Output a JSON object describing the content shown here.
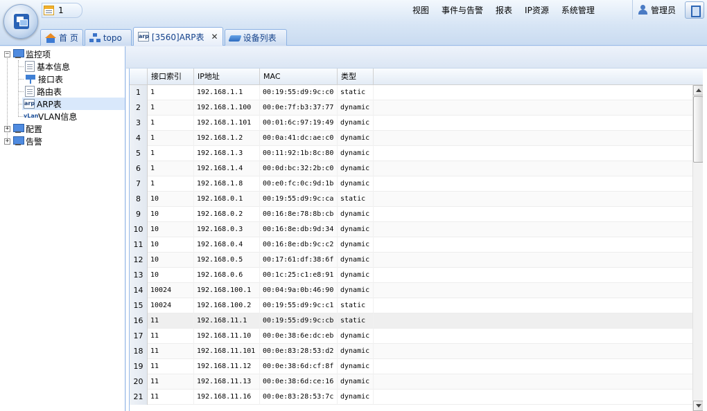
{
  "header": {
    "notification_count": "1",
    "menu": [
      "视图",
      "事件与告警",
      "报表",
      "IP资源",
      "系统管理"
    ],
    "user": "管理员"
  },
  "tabs": [
    {
      "label": "首 页",
      "icon": "home-icon"
    },
    {
      "label": "topo",
      "icon": "topology-icon"
    },
    {
      "label": "[3560]ARP表",
      "icon": "arp-table-icon",
      "badge": "arp",
      "active": true,
      "close": "✕"
    },
    {
      "label": "设备列表",
      "icon": "device-list-icon"
    }
  ],
  "tree": {
    "root": {
      "label": "监控项",
      "toggle": "−"
    },
    "children": [
      {
        "label": "基本信息",
        "icon": "basic-info-icon"
      },
      {
        "label": "接口表",
        "icon": "interface-icon"
      },
      {
        "label": "路由表",
        "icon": "route-table-icon"
      },
      {
        "label": "ARP表",
        "icon": "arp-icon",
        "badge": "arp",
        "selected": true
      },
      {
        "label": "VLAN信息",
        "icon": "vlan-icon",
        "badge": "vLan"
      }
    ],
    "others": [
      {
        "label": "配置",
        "toggle": "+"
      },
      {
        "label": "告警",
        "toggle": "+"
      }
    ]
  },
  "grid": {
    "columns": [
      "接口索引",
      "IP地址",
      "MAC",
      "类型"
    ],
    "rows": [
      {
        "n": "1",
        "idx": "1",
        "ip": "192.168.1.1",
        "mac": "00:19:55:d9:9c:c0",
        "type": "static"
      },
      {
        "n": "2",
        "idx": "1",
        "ip": "192.168.1.100",
        "mac": "00:0e:7f:b3:37:77",
        "type": "dynamic"
      },
      {
        "n": "3",
        "idx": "1",
        "ip": "192.168.1.101",
        "mac": "00:01:6c:97:19:49",
        "type": "dynamic"
      },
      {
        "n": "4",
        "idx": "1",
        "ip": "192.168.1.2",
        "mac": "00:0a:41:dc:ae:c0",
        "type": "dynamic"
      },
      {
        "n": "5",
        "idx": "1",
        "ip": "192.168.1.3",
        "mac": "00:11:92:1b:8c:80",
        "type": "dynamic"
      },
      {
        "n": "6",
        "idx": "1",
        "ip": "192.168.1.4",
        "mac": "00:0d:bc:32:2b:c0",
        "type": "dynamic"
      },
      {
        "n": "7",
        "idx": "1",
        "ip": "192.168.1.8",
        "mac": "00:e0:fc:0c:9d:1b",
        "type": "dynamic"
      },
      {
        "n": "8",
        "idx": "10",
        "ip": "192.168.0.1",
        "mac": "00:19:55:d9:9c:ca",
        "type": "static"
      },
      {
        "n": "9",
        "idx": "10",
        "ip": "192.168.0.2",
        "mac": "00:16:8e:78:8b:cb",
        "type": "dynamic"
      },
      {
        "n": "10",
        "idx": "10",
        "ip": "192.168.0.3",
        "mac": "00:16:8e:db:9d:34",
        "type": "dynamic"
      },
      {
        "n": "11",
        "idx": "10",
        "ip": "192.168.0.4",
        "mac": "00:16:8e:db:9c:c2",
        "type": "dynamic"
      },
      {
        "n": "12",
        "idx": "10",
        "ip": "192.168.0.5",
        "mac": "00:17:61:df:38:6f",
        "type": "dynamic"
      },
      {
        "n": "13",
        "idx": "10",
        "ip": "192.168.0.6",
        "mac": "00:1c:25:c1:e8:91",
        "type": "dynamic"
      },
      {
        "n": "14",
        "idx": "10024",
        "ip": "192.168.100.1",
        "mac": "00:04:9a:0b:46:90",
        "type": "dynamic"
      },
      {
        "n": "15",
        "idx": "10024",
        "ip": "192.168.100.2",
        "mac": "00:19:55:d9:9c:c1",
        "type": "static"
      },
      {
        "n": "16",
        "idx": "11",
        "ip": "192.168.11.1",
        "mac": "00:19:55:d9:9c:cb",
        "type": "static"
      },
      {
        "n": "17",
        "idx": "11",
        "ip": "192.168.11.10",
        "mac": "00:0e:38:6e:dc:eb",
        "type": "dynamic"
      },
      {
        "n": "18",
        "idx": "11",
        "ip": "192.168.11.101",
        "mac": "00:0e:83:28:53:d2",
        "type": "dynamic"
      },
      {
        "n": "19",
        "idx": "11",
        "ip": "192.168.11.12",
        "mac": "00:0e:38:6d:cf:8f",
        "type": "dynamic"
      },
      {
        "n": "20",
        "idx": "11",
        "ip": "192.168.11.13",
        "mac": "00:0e:38:6d:ce:16",
        "type": "dynamic"
      },
      {
        "n": "21",
        "idx": "11",
        "ip": "192.168.11.16",
        "mac": "00:0e:83:28:53:7c",
        "type": "dynamic"
      }
    ]
  },
  "colors": {
    "header_bg": "#d7e5f5",
    "border": "#99bbe8",
    "tab_text": "#15428b",
    "selected_row": "#d9e8fb"
  }
}
